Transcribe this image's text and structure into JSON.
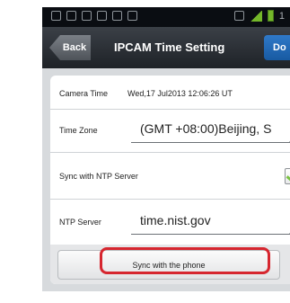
{
  "status_bar": {
    "left_icons": [
      "notification-icon",
      "notification-icon",
      "notification-icon",
      "notification-icon",
      "notification-icon",
      "notification-icon",
      "notification-icon"
    ],
    "signal_text": "",
    "time_partial": "1"
  },
  "header": {
    "back_label": "Back",
    "title": "IPCAM  Time Setting",
    "done_label": "Do"
  },
  "form": {
    "camera_time_label": "Camera Time",
    "camera_time_value": "Wed,17 Jul2013 12:06:26  UT",
    "time_zone_label": "Time Zone",
    "time_zone_value": "(GMT +08:00)Beijing, S",
    "ntp_sync_label": "Sync with NTP Server",
    "ntp_sync_checked": true,
    "ntp_server_label": "NTP Server",
    "ntp_server_value": "time.nist.gov",
    "sync_phone_label": "Sync with the phone"
  },
  "colors": {
    "highlight": "#d6262f",
    "check": "#7ac142",
    "done_button": "#1f67b5"
  }
}
